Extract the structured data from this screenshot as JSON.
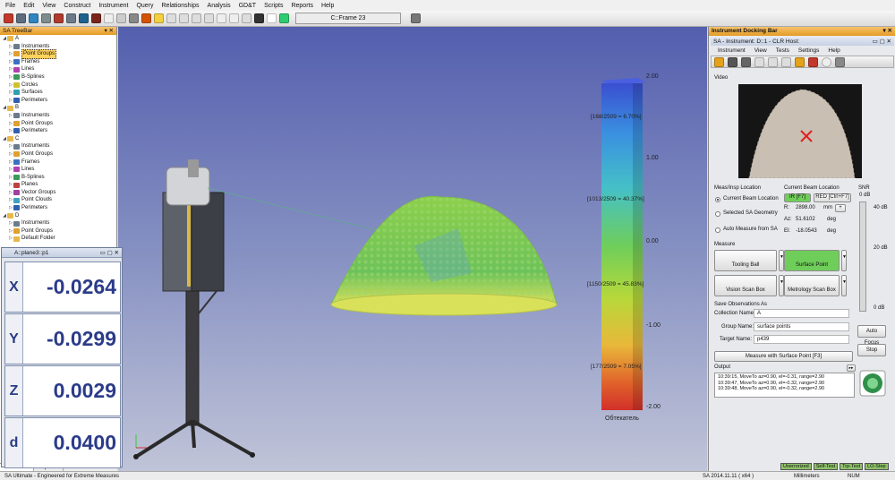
{
  "menubar": [
    "File",
    "Edit",
    "View",
    "Construct",
    "Instrument",
    "Query",
    "Relationships",
    "Analysis",
    "GD&T",
    "Scripts",
    "Reports",
    "Help"
  ],
  "toolbar": {
    "frame_field": "C::Frame 23"
  },
  "treebar": {
    "title": "SA TreeBar",
    "items": [
      {
        "level": 0,
        "label": "A",
        "icon": "folder-icon"
      },
      {
        "level": 1,
        "label": "Instruments",
        "icon": "instrument-icon"
      },
      {
        "level": 1,
        "label": "Point Groups",
        "icon": "point-group-icon",
        "selected": true
      },
      {
        "level": 1,
        "label": "Frames",
        "icon": "frame-icon"
      },
      {
        "level": 1,
        "label": "Lines",
        "icon": "line-icon"
      },
      {
        "level": 1,
        "label": "B-Splines",
        "icon": "spline-icon"
      },
      {
        "level": 1,
        "label": "Circles",
        "icon": "circle-icon"
      },
      {
        "level": 1,
        "label": "Surfaces",
        "icon": "surface-icon"
      },
      {
        "level": 1,
        "label": "Perimeters",
        "icon": "perimeter-icon"
      },
      {
        "level": 0,
        "label": "B",
        "icon": "folder-icon"
      },
      {
        "level": 1,
        "label": "Instruments",
        "icon": "instrument-icon"
      },
      {
        "level": 1,
        "label": "Point Groups",
        "icon": "point-group-icon"
      },
      {
        "level": 1,
        "label": "Perimeters",
        "icon": "perimeter-icon"
      },
      {
        "level": 0,
        "label": "C",
        "icon": "folder-icon"
      },
      {
        "level": 1,
        "label": "Instruments",
        "icon": "instrument-icon"
      },
      {
        "level": 1,
        "label": "Point Groups",
        "icon": "point-group-icon"
      },
      {
        "level": 1,
        "label": "Frames",
        "icon": "frame-icon"
      },
      {
        "level": 1,
        "label": "Lines",
        "icon": "line-icon"
      },
      {
        "level": 1,
        "label": "B-Splines",
        "icon": "spline-icon"
      },
      {
        "level": 1,
        "label": "Planes",
        "icon": "plane-icon"
      },
      {
        "level": 1,
        "label": "Vector Groups",
        "icon": "vector-icon"
      },
      {
        "level": 1,
        "label": "Point Clouds",
        "icon": "cloud-icon"
      },
      {
        "level": 1,
        "label": "Perimeters",
        "icon": "perimeter-icon"
      },
      {
        "level": 0,
        "label": "D",
        "icon": "folder-icon"
      },
      {
        "level": 1,
        "label": "Instruments",
        "icon": "instrument-icon"
      },
      {
        "level": 1,
        "label": "Point Groups",
        "icon": "point-group-icon"
      },
      {
        "level": 1,
        "label": "Default Folder",
        "icon": "folder-icon"
      }
    ],
    "tabs": [
      "Database",
      "Explorer"
    ]
  },
  "readout": {
    "title": "A::plane3::p1",
    "rows": [
      {
        "label": "X",
        "value": "-0.0264"
      },
      {
        "label": "Y",
        "value": "-0.0299"
      },
      {
        "label": "Z",
        "value": "0.0029"
      },
      {
        "label": "d",
        "value": "0.0400"
      }
    ]
  },
  "colorbar": {
    "ticks": [
      "2.00",
      "1.00",
      "0.00",
      "-1.00",
      "-2.00"
    ],
    "annotations": [
      "[168/2509 = 6.70%]",
      "[1013/2509 = 40.37%]",
      "[1150/2509 = 45.83%]",
      "[177/2509 = 7.05%]"
    ],
    "label": "Обтекатель",
    "colors": [
      "#3a5fd6",
      "#3aa4e0",
      "#6fce5a",
      "#b5d83a",
      "#e8c33a",
      "#e06a2a",
      "#d23a2a"
    ]
  },
  "dock": {
    "title": "Instrument Docking Bar",
    "inner_title": "SA - Instrument: D::1 - CLR Host:",
    "menu": [
      "Instrument",
      "View",
      "Tests",
      "Settings",
      "Help"
    ],
    "video_label": "Video",
    "meas_header": "Meas/Insp Location",
    "radio_current": "Current Beam Location",
    "radio_selected": "Selected SA Geometry",
    "radio_auto": "Auto Measure from SA",
    "beam_header": "Current Beam Location",
    "ir_button": "IR [F7]",
    "red_button": "RED [Ctrl+F7]",
    "r_label": "R:",
    "r_value": "2898.00",
    "r_unit": "mm",
    "az_label": "Az:",
    "az_value": "51.6102",
    "az_unit": "deg",
    "el_label": "El:",
    "el_value": "-18.0543",
    "el_unit": "deg",
    "snr_label": "SNR",
    "snr_value": "0 dB",
    "snr_ticks": [
      "40 dB",
      "20 dB",
      "0 dB"
    ],
    "measure_header": "Measure",
    "tooling_ball": "Tooling Ball",
    "surface_point": "Surface Point",
    "vision_scan": "Vision Scan Box",
    "metrology_scan": "Metrology Scan Box",
    "save_header": "Save Observations As",
    "collection_label": "Collection Name:",
    "collection_value": "A",
    "group_label": "Group Name:",
    "group_value": "surface points",
    "target_label": "Target Name:",
    "target_value": "p439",
    "auto_focus": "Auto Focus",
    "stop": "Stop",
    "measure_button": "Measure with Surface Point [F3]",
    "output_label": "Output",
    "output_lines": [
      "10:39:15, MoveTo az=0.90, el=-0.31, range=2.90",
      "10:39:47, MoveTo az=0.90, el=-0.32, range=2.90",
      "10:39:48, MoveTo az=0.90, el=-0.32, range=2.90"
    ],
    "status_items": [
      "Unerrorized",
      "Self-Test",
      "Trp-Test",
      "LO-Step"
    ]
  },
  "statusbar": {
    "left": "SA Ultimate - Engineered for Extreme Measures",
    "version": "SA 2014.11.11  ( x64 )",
    "units": "Millimeters",
    "num": "NUM"
  }
}
